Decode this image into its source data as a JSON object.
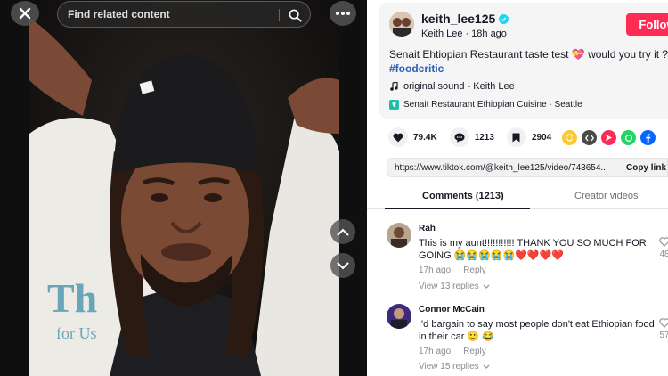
{
  "video": {
    "search": {
      "placeholder": "Find related content"
    }
  },
  "author": {
    "username": "keith_lee125",
    "display_name": "Keith Lee",
    "posted": "18h ago",
    "follow_label": "Follow"
  },
  "post": {
    "caption": "Senait Ehtiopian Restaurant taste test 💝 would you try it ?",
    "hashtag": "#foodcritic",
    "sound": "original sound - Keith Lee",
    "location": "Senait Restaurant Ethiopian Cuisine · Seattle"
  },
  "stats": {
    "likes": "79.4K",
    "comments": "1213",
    "saves": "2904"
  },
  "share": {
    "url": "https://www.tiktok.com/@keith_lee125/video/743654...",
    "copy_label": "Copy link",
    "icons": [
      "repost-icon",
      "embed-icon",
      "send-icon",
      "whatsapp-icon",
      "facebook-icon"
    ],
    "colors": {
      "repost": "#fec82f",
      "embed": "#4a4a4a",
      "send": "#fe2c55",
      "whatsapp": "#25d366",
      "facebook": "#0866ff"
    }
  },
  "tabs": {
    "comments": "Comments (1213)",
    "creator": "Creator videos"
  },
  "comments": [
    {
      "name": "Rah",
      "text": "This is my aunt!!!!!!!!!!! THANK YOU SO MUCH FOR GOING 😭😭😭😭😭❤️❤️❤️❤️",
      "time": "17h ago",
      "reply": "Reply",
      "replies": "View 13 replies",
      "likes": "48"
    },
    {
      "name": "Connor McCain",
      "text": "I'd bargain to say most people don't eat Ethiopian food in their car 🙂 😂",
      "time": "17h ago",
      "reply": "Reply",
      "replies": "View 15 replies",
      "likes": "57"
    }
  ],
  "colors": {
    "accent": "#fe2c55",
    "hashtag": "#2b5db9",
    "verified": "#20d5ec"
  }
}
